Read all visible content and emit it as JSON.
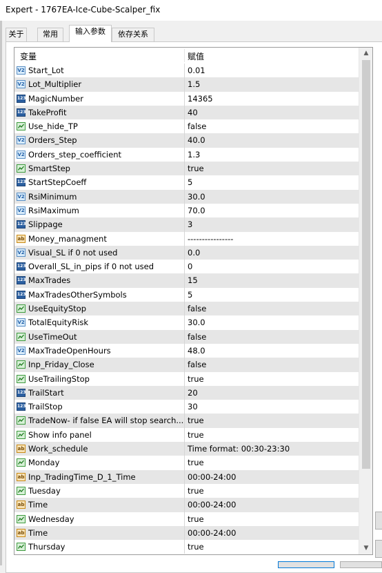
{
  "window": {
    "title": "Expert - 1767EA-Ice-Cube-Scalper_fix"
  },
  "tabs": [
    {
      "label": "关于"
    },
    {
      "label": "常用"
    },
    {
      "label": "输入参数"
    },
    {
      "label": "依存关系"
    }
  ],
  "active_tab": "输入参数",
  "grid": {
    "col_variable": "变量",
    "col_value": "赋值",
    "rows": [
      {
        "icon": "v2",
        "name": "Start_Lot",
        "value": "0.01"
      },
      {
        "icon": "v2",
        "name": "Lot_Multiplier",
        "value": "1.5"
      },
      {
        "icon": "123",
        "name": "MagicNumber",
        "value": "14365"
      },
      {
        "icon": "123",
        "name": "TakeProfit",
        "value": "40"
      },
      {
        "icon": "bool",
        "name": "Use_hide_TP",
        "value": "false"
      },
      {
        "icon": "v2",
        "name": "Orders_Step",
        "value": "40.0"
      },
      {
        "icon": "v2",
        "name": "Orders_step_coefficient",
        "value": "1.3"
      },
      {
        "icon": "bool",
        "name": "SmartStep",
        "value": "true"
      },
      {
        "icon": "123",
        "name": "StartStepCoeff",
        "value": "5"
      },
      {
        "icon": "v2",
        "name": "RsiMinimum",
        "value": "30.0"
      },
      {
        "icon": "v2",
        "name": "RsiMaximum",
        "value": "70.0"
      },
      {
        "icon": "123",
        "name": "Slippage",
        "value": "3"
      },
      {
        "icon": "ab",
        "name": "Money_managment",
        "value": "----------------"
      },
      {
        "icon": "v2",
        "name": "Visual_SL if 0 not used",
        "value": "0.0"
      },
      {
        "icon": "123",
        "name": "Overall_SL_in_pips if 0 not used",
        "value": "0"
      },
      {
        "icon": "123",
        "name": "MaxTrades",
        "value": "15"
      },
      {
        "icon": "123",
        "name": "MaxTradesOtherSymbols",
        "value": "5"
      },
      {
        "icon": "bool",
        "name": "UseEquityStop",
        "value": "false"
      },
      {
        "icon": "v2",
        "name": "TotalEquityRisk",
        "value": "30.0"
      },
      {
        "icon": "bool",
        "name": "UseTimeOut",
        "value": "false"
      },
      {
        "icon": "v2",
        "name": "MaxTradeOpenHours",
        "value": "48.0"
      },
      {
        "icon": "bool",
        "name": "Inp_Friday_Close",
        "value": "false"
      },
      {
        "icon": "bool",
        "name": "UseTrailingStop",
        "value": "true"
      },
      {
        "icon": "123",
        "name": "TrailStart",
        "value": "20"
      },
      {
        "icon": "123",
        "name": "TrailStop",
        "value": "30"
      },
      {
        "icon": "bool",
        "name": "TradeNow- if false EA will stop search...",
        "value": "true"
      },
      {
        "icon": "bool",
        "name": "Show info panel",
        "value": "true"
      },
      {
        "icon": "ab",
        "name": "Work_schedule",
        "value": "Time format: 00:30-23:30"
      },
      {
        "icon": "bool",
        "name": "Monday",
        "value": "true"
      },
      {
        "icon": "ab",
        "name": "Inp_TradingTime_D_1_Time",
        "value": "00:00-24:00"
      },
      {
        "icon": "bool",
        "name": "Tuesday",
        "value": "true"
      },
      {
        "icon": "ab",
        "name": "Time",
        "value": "00:00-24:00"
      },
      {
        "icon": "bool",
        "name": "Wednesday",
        "value": "true"
      },
      {
        "icon": "ab",
        "name": "Time",
        "value": "00:00-24:00"
      },
      {
        "icon": "bool",
        "name": "Thursday",
        "value": "true"
      }
    ]
  },
  "scroll": {
    "up_arrow": "▲",
    "down_arrow": "▼"
  },
  "colors": {
    "accent": "#0078d7",
    "selected_row": "#e6e6e6"
  }
}
